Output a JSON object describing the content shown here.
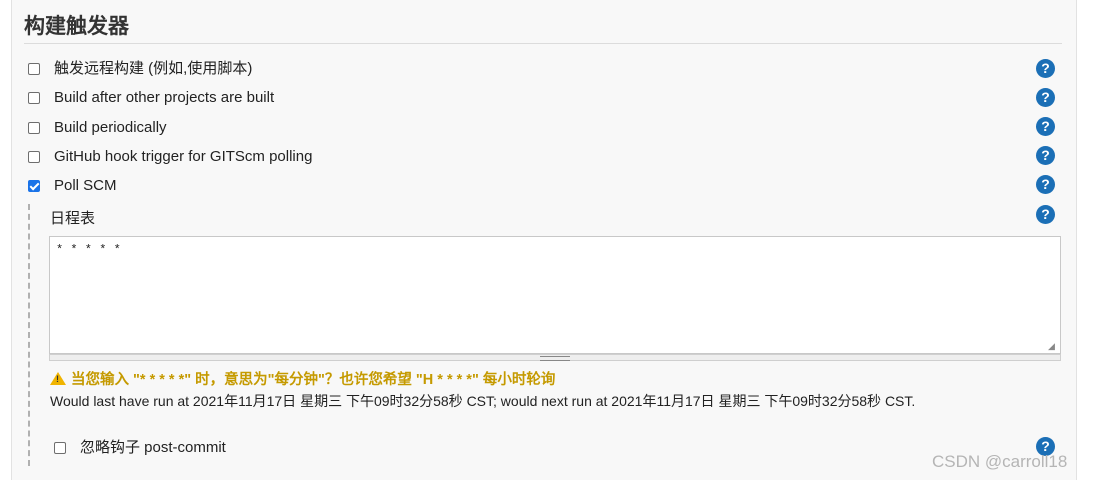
{
  "section": {
    "title": "构建触发器"
  },
  "triggers": [
    {
      "label": "触发远程构建 (例如,使用脚本)",
      "checked": false
    },
    {
      "label": "Build after other projects are built",
      "checked": false
    },
    {
      "label": "Build periodically",
      "checked": false
    },
    {
      "label": "GitHub hook trigger for GITScm polling",
      "checked": false
    },
    {
      "label": "Poll SCM",
      "checked": true
    }
  ],
  "help_icon": "?",
  "poll_scm": {
    "schedule_label": "日程表",
    "schedule_value": "* * * * *",
    "warning_text": "当您输入 \"* * * * *\" 时，意思为\"每分钟\"？也许您希望 \"H * * * *\" 每小时轮询",
    "warning_icon": "!",
    "run_info": "Would last have run at 2021年11月17日 星期三 下午09时32分58秒 CST; would next run at 2021年11月17日 星期三 下午09时32分58秒 CST.",
    "ignore_post_commit_label": "忽略钩子 post-commit",
    "ignore_post_commit_checked": false
  },
  "watermark": "CSDN @carroll18",
  "colors": {
    "help": "#1b6fb6",
    "warning": "#c59a00",
    "checkbox_checked": "#1a73e8"
  }
}
